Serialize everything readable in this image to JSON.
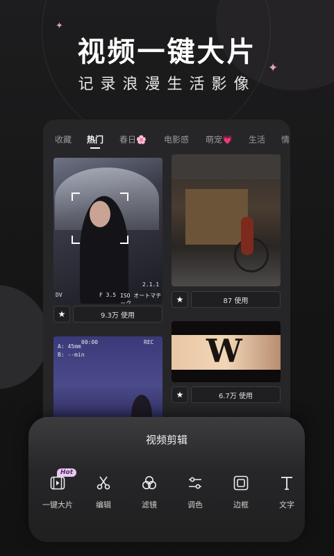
{
  "header": {
    "title": "视频一键大片",
    "subtitle": "记录浪漫生活影像"
  },
  "tabs": [
    {
      "label": "收藏"
    },
    {
      "label": "热门"
    },
    {
      "label": "春日🌸"
    },
    {
      "label": "电影感"
    },
    {
      "label": "萌宠💗"
    },
    {
      "label": "生活"
    },
    {
      "label": "情"
    }
  ],
  "templates": [
    {
      "uses": "9.3万 使用",
      "overlay": [
        "DV",
        "F 3.5",
        "ISO オートマチック",
        "2.1.1"
      ]
    },
    {
      "uses": "87 使用"
    },
    {
      "overlay": [
        "A: 45mm",
        "B: --min",
        "REC",
        "00:00"
      ]
    },
    {
      "uses": "6.7万 使用"
    }
  ],
  "sheet": {
    "title": "视频剪辑",
    "hot_badge": "Hot",
    "tools": [
      {
        "label": "一键大片",
        "icon": "film-play-icon"
      },
      {
        "label": "编辑",
        "icon": "scissors-icon"
      },
      {
        "label": "滤镜",
        "icon": "filter-circles-icon"
      },
      {
        "label": "调色",
        "icon": "sliders-icon"
      },
      {
        "label": "边框",
        "icon": "frame-icon"
      },
      {
        "label": "文字",
        "icon": "text-icon"
      }
    ]
  },
  "colors": {
    "accent_star": "#e3a2b1",
    "hot_badge_bg": "#e7c9f0"
  }
}
